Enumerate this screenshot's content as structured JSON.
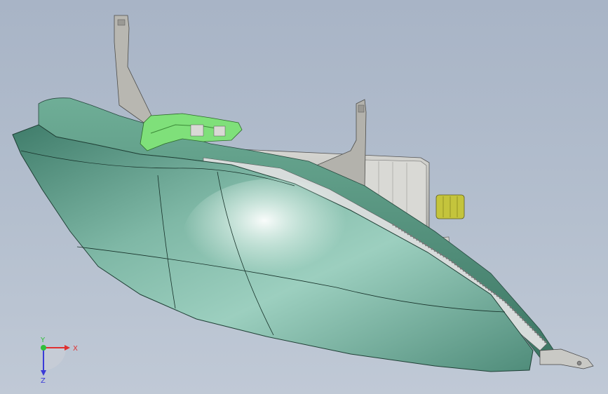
{
  "viewport": {
    "background_top": "#a8b4c6",
    "background_bottom": "#c0c9d6"
  },
  "model": {
    "lens_color": "#5f9e8b",
    "lens_highlight": "#f4fbf8",
    "housing_color": "#c8c8c4",
    "bracket_color": "#b5b4ae",
    "clip_color": "#7fe07a",
    "connector_color": "#c2c23a"
  },
  "triad": {
    "x_label": "X",
    "y_label": "Y",
    "z_label": "Z",
    "x_color": "#e03030",
    "y_color": "#2fbf3a",
    "z_color": "#3a3ad8"
  }
}
